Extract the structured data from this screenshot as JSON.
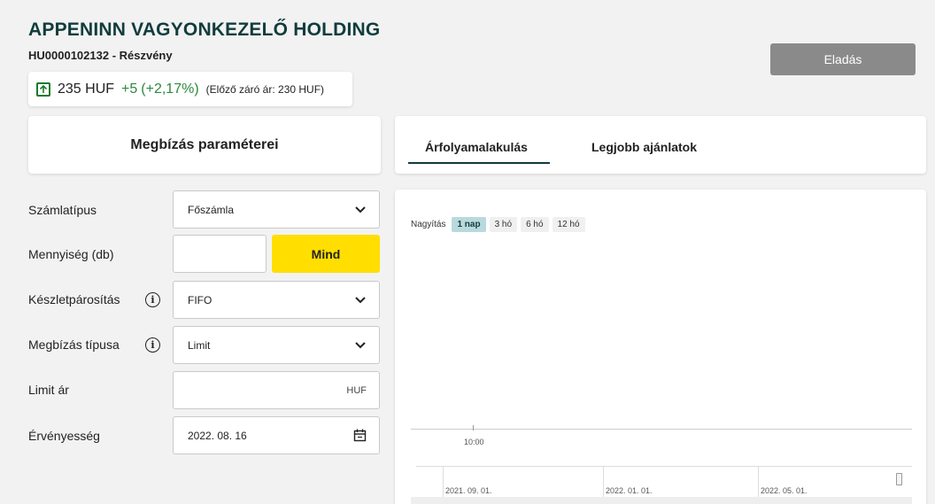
{
  "header": {
    "title": "APPENINN VAGYONKEZELŐ HOLDING",
    "subtitle": "HU0000102132 - Részvény",
    "price": "235 HUF",
    "change": "+5",
    "change_pct": "(+2,17%)",
    "previous_close": "(Előző záró ár: 230 HUF)",
    "sell_button": "Eladás"
  },
  "order_panel": {
    "heading": "Megbízás paraméterei",
    "fields": {
      "account_type": {
        "label": "Számlatípus",
        "value": "Főszámla"
      },
      "quantity": {
        "label": "Mennyiség (db)",
        "value": "",
        "all_button": "Mind"
      },
      "matching": {
        "label": "Készletpárosítás",
        "value": "FIFO"
      },
      "order_type": {
        "label": "Megbízás típusa",
        "value": "Limit"
      },
      "limit_price": {
        "label": "Limit ár",
        "value": "",
        "unit": "HUF"
      },
      "validity": {
        "label": "Érvényesség",
        "value": "2022. 08. 16"
      }
    }
  },
  "tabs": [
    {
      "label": "Árfolyamalakulás",
      "active": true
    },
    {
      "label": "Legjobb ajánlatok",
      "active": false
    }
  ],
  "chart": {
    "zoom_label": "Nagyítás",
    "zoom_options": [
      "1 nap",
      "3 hó",
      "6 hó",
      "12 hó"
    ],
    "zoom_selected": "1 nap",
    "x_tick": "10:00",
    "navigator_labels": [
      "2021. 09. 01.",
      "2022. 01. 01.",
      "2022. 05. 01."
    ]
  },
  "colors": {
    "title": "#123c3d",
    "positive": "#2b8a3e",
    "accent_button": "#ffde00",
    "disabled_button": "#8a8a8a"
  },
  "icons": [
    "arrow-up-icon",
    "chevron-down-icon",
    "info-icon",
    "calendar-icon"
  ]
}
